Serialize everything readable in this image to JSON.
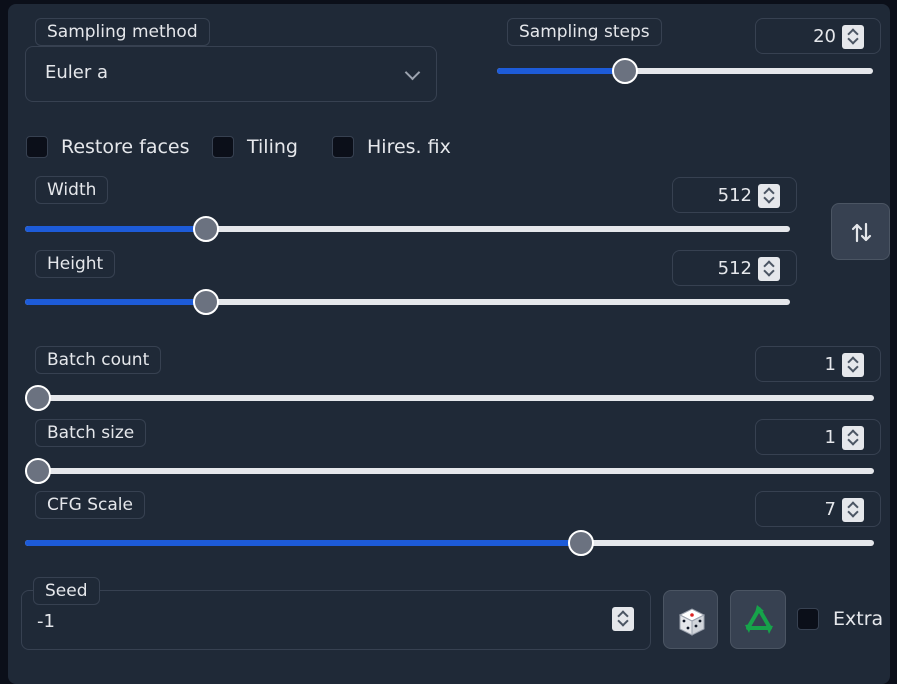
{
  "sampling": {
    "method_label": "Sampling method",
    "method_value": "Euler a",
    "steps_label": "Sampling steps",
    "steps_value": "20",
    "steps_fraction": 0.34
  },
  "checkboxes": {
    "restore_faces": "Restore faces",
    "tiling": "Tiling",
    "hires_fix": "Hires. fix",
    "extra": "Extra"
  },
  "width": {
    "label": "Width",
    "value": "512",
    "fraction": 0.236
  },
  "height": {
    "label": "Height",
    "value": "512",
    "fraction": 0.236
  },
  "batch_count": {
    "label": "Batch count",
    "value": "1",
    "fraction": 0.0
  },
  "batch_size": {
    "label": "Batch size",
    "value": "1",
    "fraction": 0.0
  },
  "cfg_scale": {
    "label": "CFG Scale",
    "value": "7",
    "fraction": 0.655
  },
  "seed": {
    "label": "Seed",
    "value": "-1"
  },
  "icons": {
    "swap": "swap-vertical-icon",
    "dice": "dice-icon",
    "recycle": "recycle-icon"
  },
  "colors": {
    "accent": "#1d5bd8",
    "panel": "#1f2937",
    "recycle": "#16a34a"
  }
}
